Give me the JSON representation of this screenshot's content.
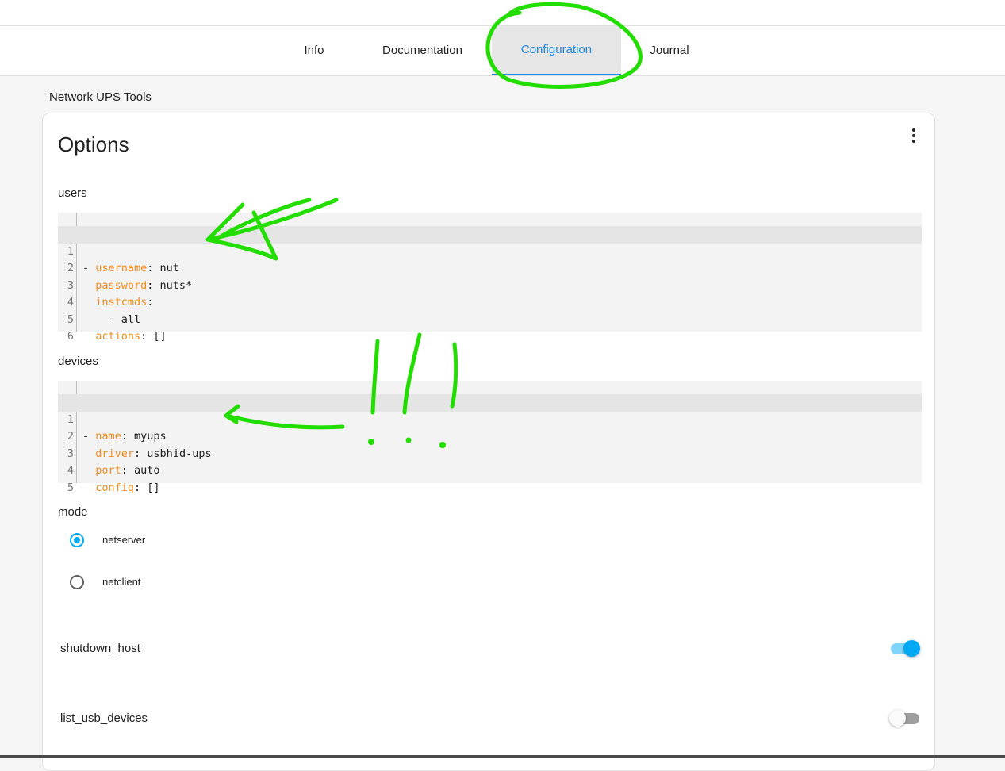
{
  "tabs": [
    {
      "label": "Info"
    },
    {
      "label": "Documentation"
    },
    {
      "label": "Configuration",
      "active": true
    },
    {
      "label": "Journal"
    }
  ],
  "addon_name": "Network UPS Tools",
  "card": {
    "title": "Options",
    "menu_icon": "dots-vertical-icon",
    "users": {
      "label": "users",
      "lines": [
        {
          "num": "1",
          "prefix": "- ",
          "key": "username",
          "value": ": nut"
        },
        {
          "num": "2",
          "prefix": "  ",
          "key": "password",
          "value": ": nuts*"
        },
        {
          "num": "3",
          "prefix": "  ",
          "key": "instcmds",
          "value": ":"
        },
        {
          "num": "4",
          "prefix": "",
          "key": "",
          "value": "    - all"
        },
        {
          "num": "5",
          "prefix": "  ",
          "key": "actions",
          "value": ": []"
        },
        {
          "num": "6",
          "prefix": "",
          "key": "",
          "value": ""
        }
      ]
    },
    "devices": {
      "label": "devices",
      "lines": [
        {
          "num": "1",
          "prefix": "- ",
          "key": "name",
          "value": ": myups"
        },
        {
          "num": "2",
          "prefix": "  ",
          "key": "driver",
          "value": ": usbhid-ups"
        },
        {
          "num": "3",
          "prefix": "  ",
          "key": "port",
          "value": ": auto"
        },
        {
          "num": "4",
          "prefix": "  ",
          "key": "config",
          "value": ": []"
        },
        {
          "num": "5",
          "prefix": "",
          "key": "",
          "value": ""
        }
      ]
    },
    "mode": {
      "label": "mode",
      "options": [
        {
          "label": "netserver",
          "selected": true
        },
        {
          "label": "netclient",
          "selected": false
        }
      ]
    },
    "shutdown_host": {
      "label": "shutdown_host",
      "enabled": true
    },
    "list_usb_devices": {
      "label": "list_usb_devices",
      "enabled": false
    }
  },
  "colors": {
    "accent": "#03a9f4",
    "tab_active": "#1e88e5",
    "yaml_key": "#f28c1e",
    "annotation": "#22dd00"
  }
}
